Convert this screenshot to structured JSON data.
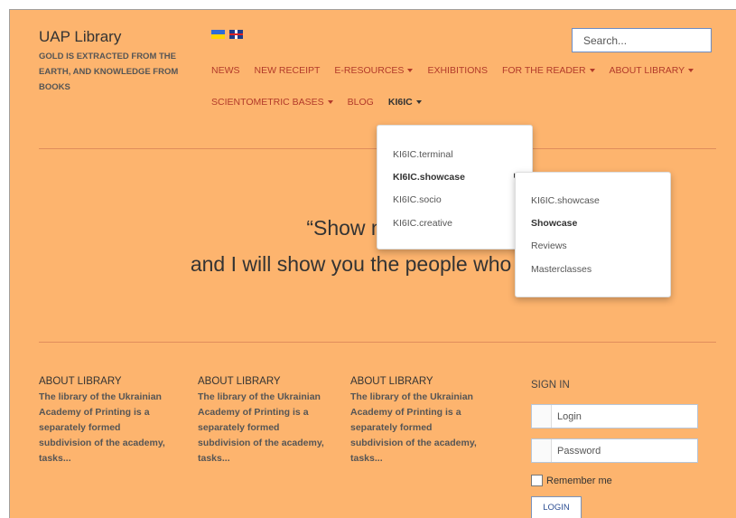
{
  "brand": {
    "title": "UAP Library",
    "tagline": "GOLD IS EXTRACTED FROM THE EARTH, AND KNOWLEDGE FROM BOOKS"
  },
  "flags": [
    "ukraine-flag",
    "uk-flag"
  ],
  "search": {
    "placeholder": "Search..."
  },
  "nav": {
    "row1": [
      {
        "label": "NEWS",
        "caret": false
      },
      {
        "label": "NEW RECEIPT",
        "caret": false
      },
      {
        "label": "E-RESOURCES",
        "caret": true
      },
      {
        "label": "EXHIBITIONS",
        "caret": false
      },
      {
        "label": "FOR THE READER",
        "caret": true
      },
      {
        "label": "ABOUT LIBRARY",
        "caret": true
      }
    ],
    "row2": [
      {
        "label": "SCIENTOMETRIC BASES",
        "caret": true
      },
      {
        "label": "BLOG",
        "caret": false
      },
      {
        "label": "KI6IC",
        "caret": true,
        "active": true
      }
    ]
  },
  "quote": {
    "line1": "“Show me a fa",
    "line2": "and I will show you the people who mov"
  },
  "dropdown": {
    "items": [
      "KI6IC.terminal",
      "KI6IC.showcase",
      "KI6IC.socio",
      "KI6IC.creative"
    ],
    "active_index": 1
  },
  "submenu": {
    "items": [
      "KI6IC.showcase",
      "Showcase",
      "Reviews",
      "Masterclasses"
    ],
    "active_index": 1
  },
  "footer": {
    "columns": [
      {
        "title": "ABOUT LIBRARY",
        "text": "The library of the Ukrainian Academy of Printing is a separately formed subdivision of the academy, tasks..."
      },
      {
        "title": "ABOUT LIBRARY",
        "text": "The library of the Ukrainian Academy of Printing is a separately formed subdivision of the academy, tasks..."
      },
      {
        "title": "ABOUT LIBRARY",
        "text": "The library of the Ukrainian Academy of Printing is a separately formed subdivision of the academy, tasks..."
      }
    ]
  },
  "signin": {
    "title": "SIGN IN",
    "login_placeholder": "Login",
    "password_placeholder": "Password",
    "remember_label": "Remember me",
    "button_label": "LOGIN"
  },
  "colors": {
    "background": "#fdb46e",
    "nav_link": "#b23a2a",
    "accent": "#2c4e93"
  }
}
